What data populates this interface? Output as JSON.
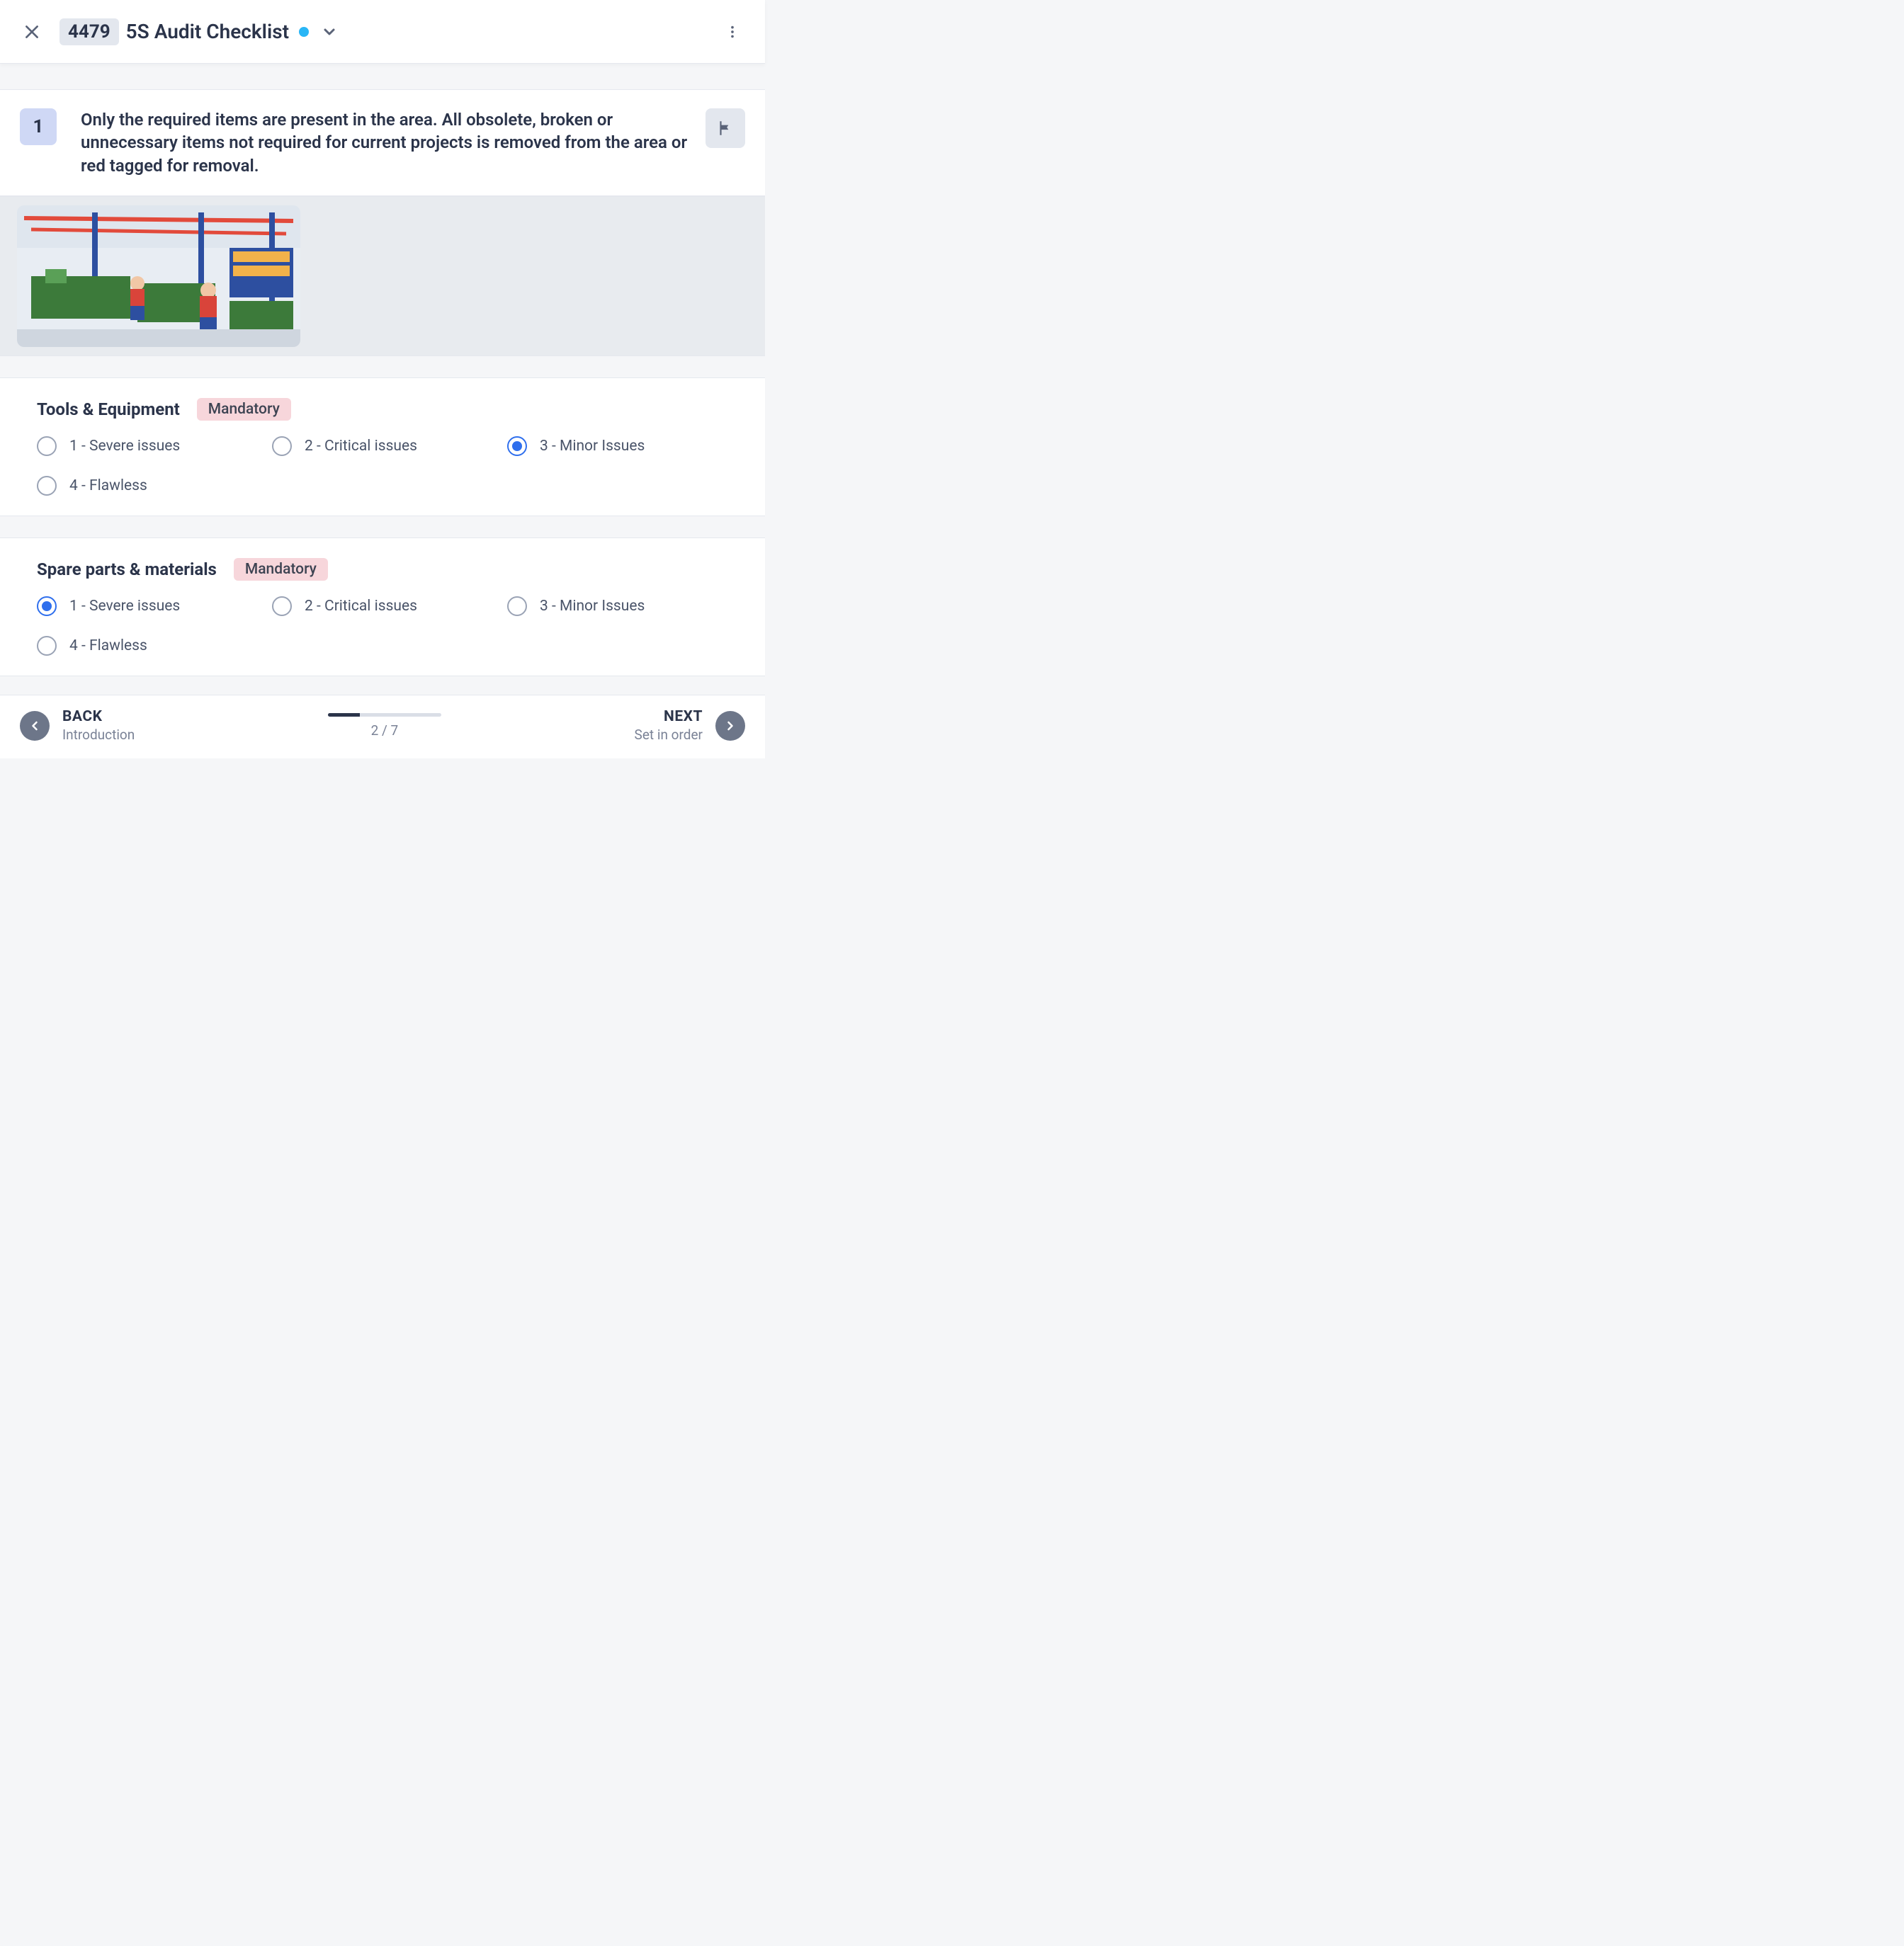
{
  "header": {
    "id": "4479",
    "title": "5S Audit Checklist"
  },
  "question": {
    "number": "1",
    "text": "Only the required items are present in the area. All obsolete, broken or unnecessary items not required for current projects is removed from the area or red tagged for removal."
  },
  "sections": [
    {
      "title": "Tools & Equipment",
      "badge": "Mandatory",
      "selectedIndex": 2,
      "options": [
        "1 - Severe issues",
        "2 - Critical issues",
        "3 - Minor Issues",
        "4 - Flawless"
      ]
    },
    {
      "title": "Spare parts & materials",
      "badge": "Mandatory",
      "selectedIndex": 0,
      "options": [
        "1 - Severe issues",
        "2 - Critical issues",
        "3 - Minor Issues",
        "4 - Flawless"
      ]
    }
  ],
  "footer": {
    "back_label": "BACK",
    "back_sub": "Introduction",
    "next_label": "NEXT",
    "next_sub": "Set in order",
    "page_text": "2 / 7",
    "progress_percent": 28
  }
}
